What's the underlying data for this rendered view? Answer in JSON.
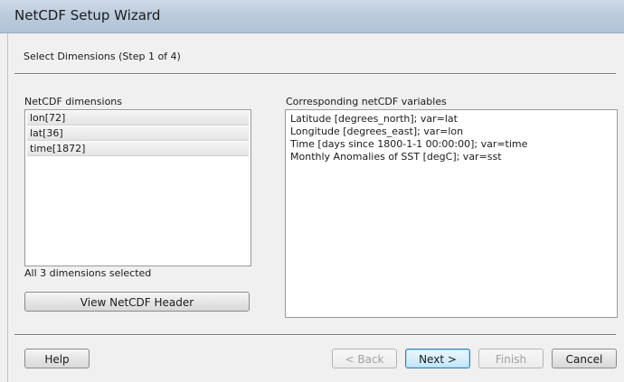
{
  "window": {
    "title": "NetCDF Setup Wizard"
  },
  "step": {
    "text": "Select Dimensions (Step 1 of 4)"
  },
  "dimensions": {
    "label": "NetCDF dimensions",
    "items": [
      "lon[72]",
      "lat[36]",
      "time[1872]"
    ],
    "status": "All 3 dimensions selected"
  },
  "variables": {
    "label": "Corresponding netCDF variables",
    "lines": [
      "Latitude [degrees_north]; var=lat",
      "Longitude [degrees_east]; var=lon",
      "Time [days since 1800-1-1 00:00:00]; var=time",
      "Monthly Anomalies of SST [degC]; var=sst"
    ]
  },
  "buttons": {
    "view_header": "View NetCDF Header",
    "help": "Help",
    "back": "< Back",
    "next": "Next >",
    "finish": "Finish",
    "cancel": "Cancel"
  }
}
